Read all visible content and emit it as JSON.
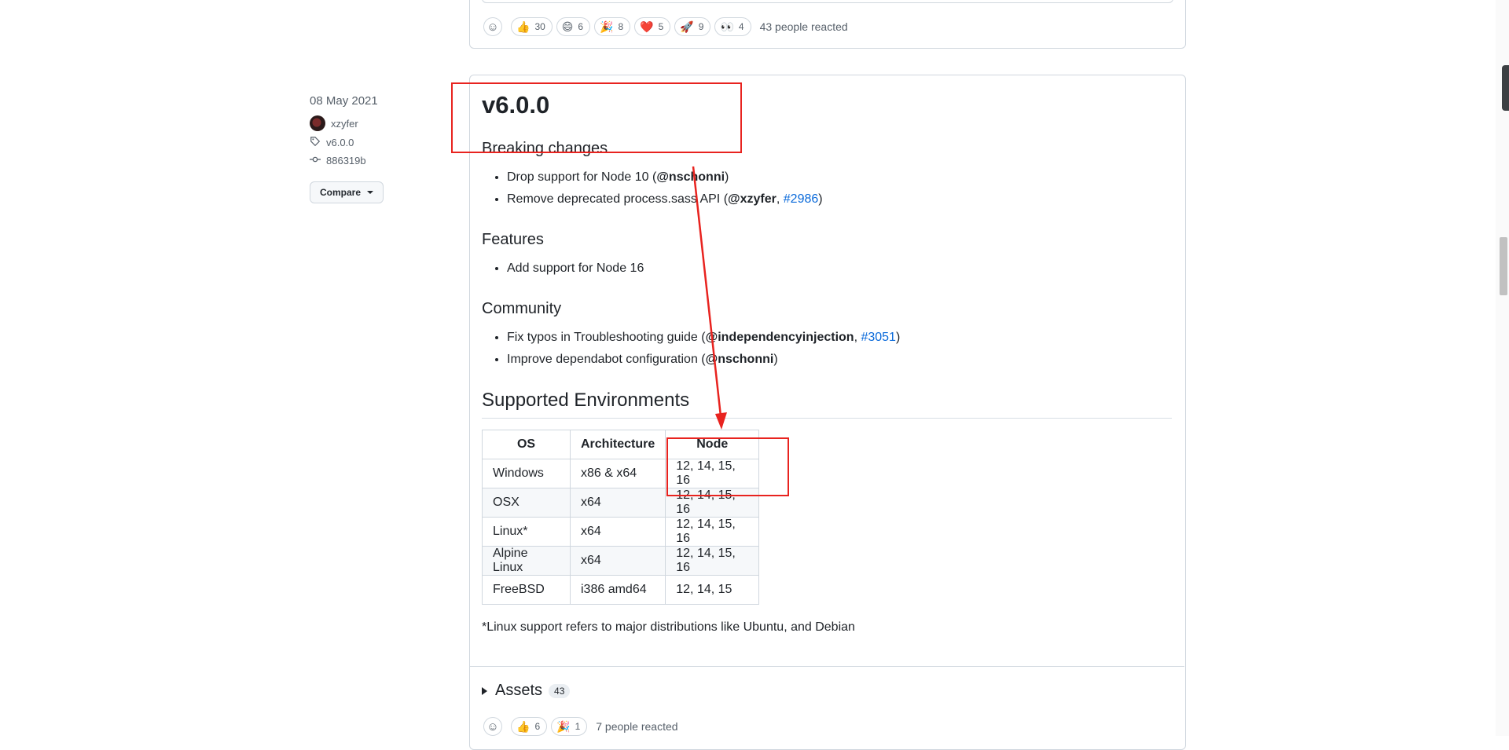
{
  "top_reactions": {
    "items": [
      {
        "emoji": "👍",
        "count": "30",
        "name": "thumbs-up"
      },
      {
        "emoji": "😄",
        "count": "6",
        "name": "smile"
      },
      {
        "emoji": "🎉",
        "count": "8",
        "name": "hooray"
      },
      {
        "emoji": "❤️",
        "count": "5",
        "name": "heart"
      },
      {
        "emoji": "🚀",
        "count": "9",
        "name": "rocket"
      },
      {
        "emoji": "👀",
        "count": "4",
        "name": "eyes"
      }
    ],
    "summary": "43 people reacted"
  },
  "release": {
    "date": "08 May 2021",
    "author": "xzyfer",
    "tag": "v6.0.0",
    "commit": "886319b",
    "compare_label": "Compare",
    "title": "v6.0.0",
    "breaking_heading": "Breaking changes",
    "breaking": [
      {
        "pre": "Drop support for Node 10 (",
        "user": "@nschonni",
        "post": ")"
      },
      {
        "pre": "Remove deprecated process.sass API (",
        "user": "@xzyfer",
        "mid": ", ",
        "link": "#2986",
        "post": ")"
      }
    ],
    "features_heading": "Features",
    "features": [
      "Add support for Node 16"
    ],
    "community_heading": "Community",
    "community": [
      {
        "pre": "Fix typos in Troubleshooting guide (",
        "user": "@independencyinjection",
        "mid": ", ",
        "link": "#3051",
        "post": ")"
      },
      {
        "pre": "Improve dependabot configuration (",
        "user": "@nschonni",
        "post": ")"
      }
    ],
    "env_heading": "Supported Environments",
    "env_table": {
      "headers": [
        "OS",
        "Architecture",
        "Node"
      ],
      "rows": [
        [
          "Windows",
          "x86 & x64",
          "12, 14, 15, 16"
        ],
        [
          "OSX",
          "x64",
          "12, 14, 15, 16"
        ],
        [
          "Linux*",
          "x64",
          "12, 14, 15, 16"
        ],
        [
          "Alpine Linux",
          "x64",
          "12, 14, 15, 16"
        ],
        [
          "FreeBSD",
          "i386 amd64",
          "12, 14, 15"
        ]
      ]
    },
    "note": "*Linux support refers to major distributions like Ubuntu, and Debian",
    "assets_label": "Assets",
    "assets_count": "43"
  },
  "bottom_reactions": {
    "items": [
      {
        "emoji": "👍",
        "count": "6",
        "name": "thumbs-up"
      },
      {
        "emoji": "🎉",
        "count": "1",
        "name": "hooray"
      }
    ],
    "summary": "7 people reacted"
  },
  "colors": {
    "annotation": "#e8231f",
    "link": "#0969da",
    "border": "#d0d7de"
  }
}
